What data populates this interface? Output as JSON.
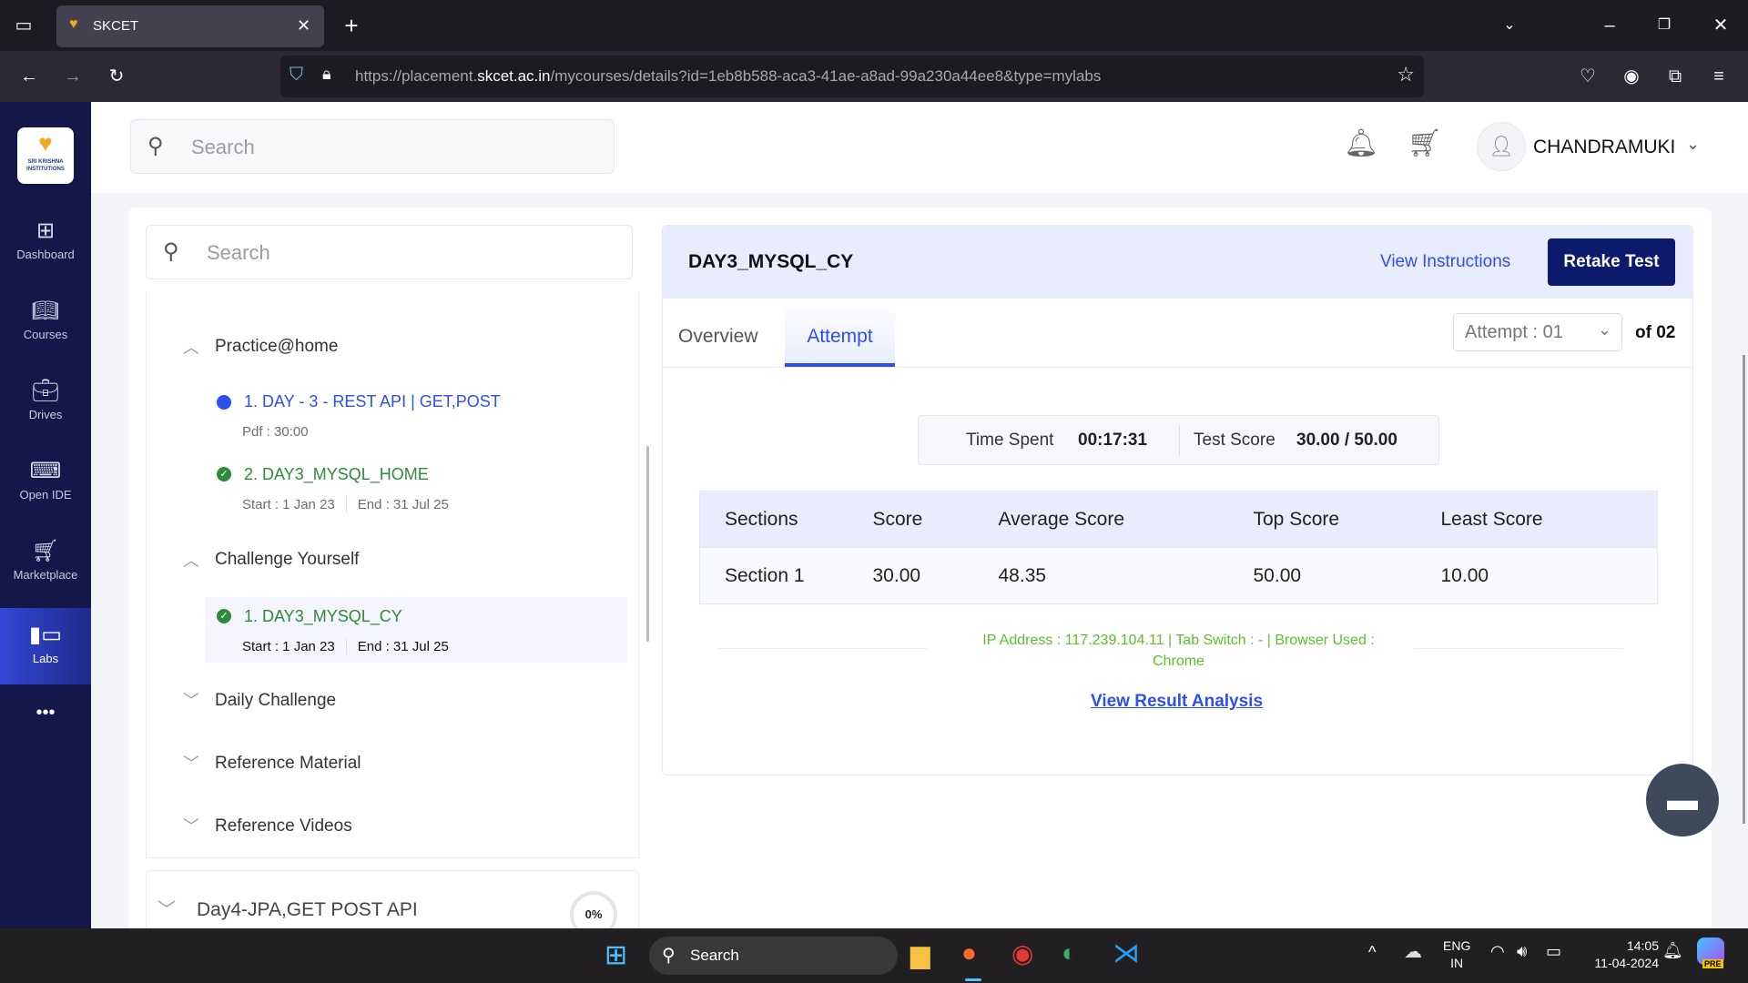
{
  "browser": {
    "tab_title": "SKCET",
    "url_prefix": "https://placement.",
    "url_domain": "skcet.ac.in",
    "url_path": "/mycourses/details?id=1eb8b588-aca3-41ae-a8ad-99a230a44ee8&type=mylabs"
  },
  "sidebar": {
    "logo_text": "SRI KRISHNA INSTITUTIONS",
    "items": [
      {
        "label": "Dashboard",
        "icon": "grid-icon"
      },
      {
        "label": "Courses",
        "icon": "book-icon"
      },
      {
        "label": "Drives",
        "icon": "briefcase-icon"
      },
      {
        "label": "Open IDE",
        "icon": "terminal-icon"
      },
      {
        "label": "Marketplace",
        "icon": "cart-icon"
      },
      {
        "label": "Labs",
        "icon": "labs-icon"
      }
    ],
    "more": "•••"
  },
  "header": {
    "search_placeholder": "Search",
    "user_name": "CHANDRAMUKI"
  },
  "left_panel": {
    "search_placeholder": "Search",
    "groups": [
      {
        "title": "Practice@home",
        "items": [
          {
            "title": "1. DAY - 3 - REST API | GET,POST",
            "meta": "Pdf : 30:00"
          },
          {
            "title": "2. DAY3_MYSQL_HOME",
            "start": "Start : 1 Jan 23",
            "end": "End : 31 Jul 25"
          }
        ]
      },
      {
        "title": "Challenge Yourself",
        "items": [
          {
            "title": "1. DAY3_MYSQL_CY",
            "start": "Start : 1 Jan 23",
            "end": "End : 31 Jul 25"
          }
        ]
      },
      {
        "title": "Daily Challenge"
      },
      {
        "title": "Reference Material"
      },
      {
        "title": "Reference Videos"
      }
    ],
    "next_day": {
      "title": "Day4-JPA,GET POST API",
      "progress": "0%"
    }
  },
  "test": {
    "title": "DAY3_MYSQL_CY",
    "view_instructions": "View Instructions",
    "retake": "Retake Test",
    "tabs": [
      "Overview",
      "Attempt"
    ],
    "active_tab": "Attempt",
    "attempt_select": "Attempt : 01",
    "attempt_of": "of 02",
    "time_spent_label": "Time Spent",
    "time_spent": "00:17:31",
    "test_score_label": "Test Score",
    "test_score": "30.00 / 50.00",
    "table": {
      "headers": [
        "Sections",
        "Score",
        "Average Score",
        "Top Score",
        "Least Score"
      ],
      "rows": [
        [
          "Section 1",
          "30.00",
          "48.35",
          "50.00",
          "10.00"
        ]
      ]
    },
    "ip_line": "IP Address : 117.239.104.11 | Tab Switch : - | Browser Used :",
    "browser_used": "Chrome",
    "result_link": "View Result Analysis"
  },
  "taskbar": {
    "search": "Search",
    "lang1": "ENG",
    "lang2": "IN",
    "time": "14:05",
    "date": "11-04-2024",
    "badge": "PRE"
  }
}
